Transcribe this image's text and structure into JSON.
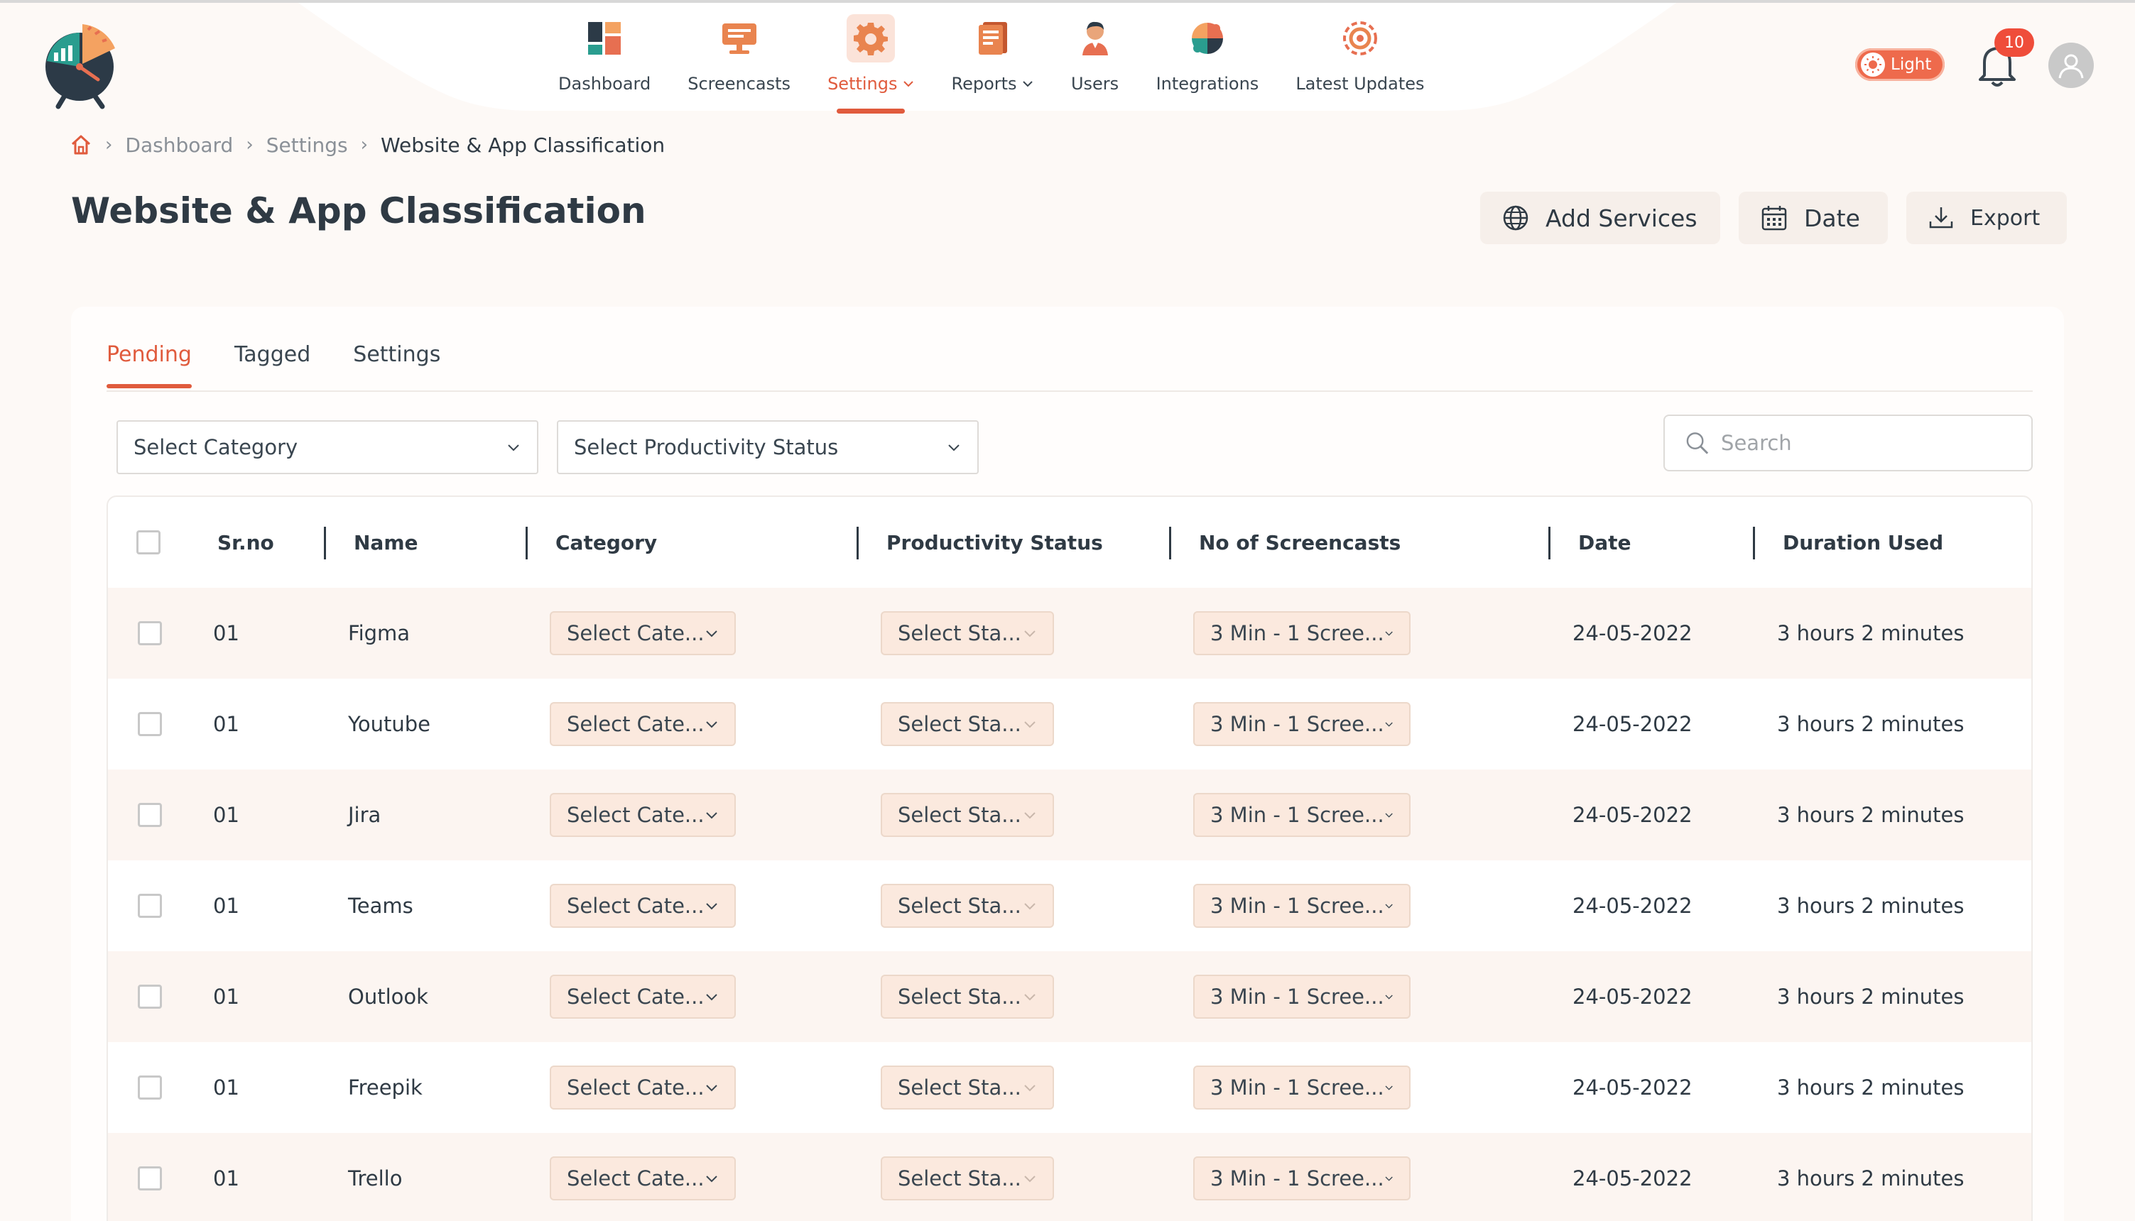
{
  "nav": {
    "items": [
      {
        "label": "Dashboard",
        "icon": "dashboard-icon",
        "active": false,
        "dropdown": false
      },
      {
        "label": "Screencasts",
        "icon": "screencasts-icon",
        "active": false,
        "dropdown": false
      },
      {
        "label": "Settings",
        "icon": "settings-icon",
        "active": true,
        "dropdown": true
      },
      {
        "label": "Reports",
        "icon": "reports-icon",
        "active": false,
        "dropdown": true
      },
      {
        "label": "Users",
        "icon": "users-icon",
        "active": false,
        "dropdown": false
      },
      {
        "label": "Integrations",
        "icon": "integrations-icon",
        "active": false,
        "dropdown": false
      },
      {
        "label": "Latest Updates",
        "icon": "latest-updates-icon",
        "active": false,
        "dropdown": false
      }
    ]
  },
  "header": {
    "theme_label": "Light",
    "notification_count": "10"
  },
  "breadcrumb": {
    "items": [
      "Dashboard",
      "Settings"
    ],
    "current": "Website & App Classification"
  },
  "page": {
    "title": "Website & App Classification"
  },
  "actions": {
    "add_services": "Add Services",
    "date": "Date",
    "export": "Export"
  },
  "tabs": [
    {
      "label": "Pending",
      "active": true
    },
    {
      "label": "Tagged",
      "active": false
    },
    {
      "label": "Settings",
      "active": false
    }
  ],
  "filters": {
    "category": "Select Category",
    "productivity": "Select Productivity Status",
    "search_placeholder": "Search"
  },
  "table": {
    "columns": [
      "Sr.no",
      "Name",
      "Category",
      "Productivity Status",
      "No of Screencasts",
      "Date",
      "Duration Used"
    ],
    "rows": [
      {
        "srno": "01",
        "name": "Figma",
        "category": "Select Cate...",
        "status": "Select Sta...",
        "screencasts": "3 Min - 1 Scree...",
        "date": "24-05-2022",
        "duration": "3 hours 2 minutes"
      },
      {
        "srno": "01",
        "name": "Youtube",
        "category": "Select Cate...",
        "status": "Select Sta...",
        "screencasts": "3 Min - 1 Scree...",
        "date": "24-05-2022",
        "duration": "3 hours 2 minutes"
      },
      {
        "srno": "01",
        "name": "Jira",
        "category": "Select Cate...",
        "status": "Select Sta...",
        "screencasts": "3 Min - 1 Scree...",
        "date": "24-05-2022",
        "duration": "3 hours 2 minutes"
      },
      {
        "srno": "01",
        "name": "Teams",
        "category": "Select Cate...",
        "status": "Select Sta...",
        "screencasts": "3 Min - 1 Scree...",
        "date": "24-05-2022",
        "duration": "3 hours 2 minutes"
      },
      {
        "srno": "01",
        "name": "Outlook",
        "category": "Select Cate...",
        "status": "Select Sta...",
        "screencasts": "3 Min - 1 Scree...",
        "date": "24-05-2022",
        "duration": "3 hours 2 minutes"
      },
      {
        "srno": "01",
        "name": "Freepik",
        "category": "Select Cate...",
        "status": "Select Sta...",
        "screencasts": "3 Min - 1 Scree...",
        "date": "24-05-2022",
        "duration": "3 hours 2 minutes"
      },
      {
        "srno": "01",
        "name": "Trello",
        "category": "Select Cate...",
        "status": "Select Sta...",
        "screencasts": "3 Min - 1 Scree...",
        "date": "24-05-2022",
        "duration": "3 hours 2 minutes"
      }
    ]
  },
  "colors": {
    "accent": "#e05b3d",
    "text": "#2f3a44",
    "background": "#fdf9f6",
    "pill": "#fbe9de",
    "badge": "#ef4d3a"
  }
}
